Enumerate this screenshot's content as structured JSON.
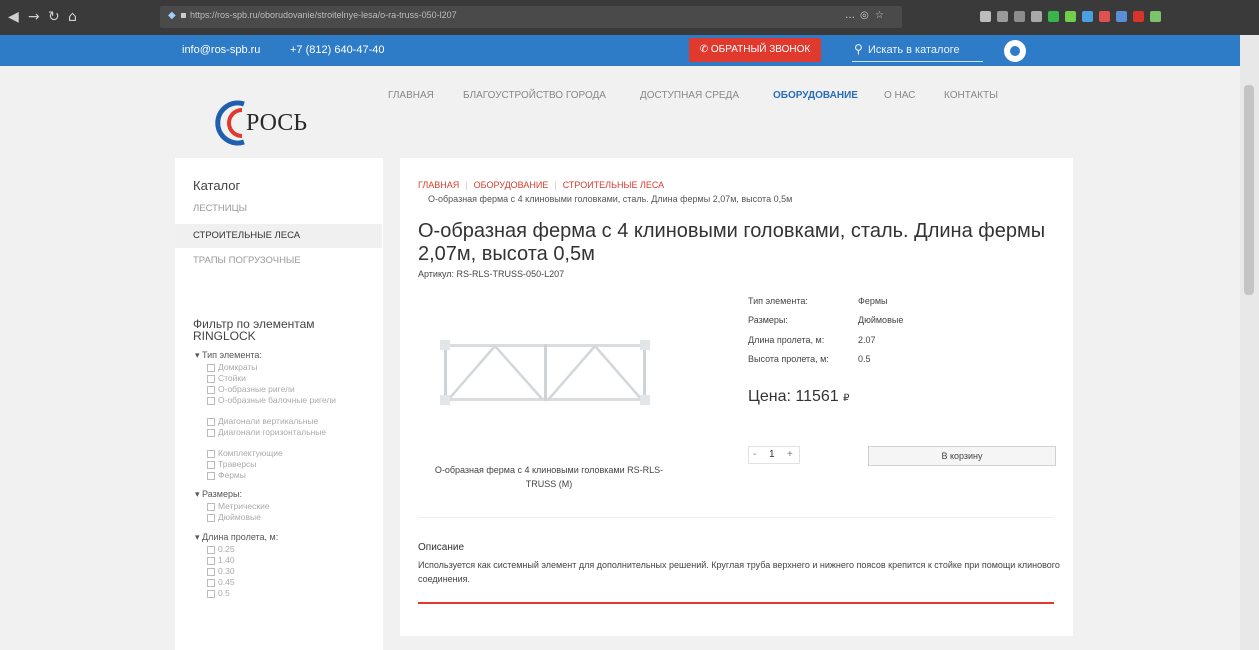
{
  "browser": {
    "url": "https://ros-spb.ru/oborudovanie/stroitelnye-lesa/o-ra-truss-050-l207",
    "url_domain": "ros-spb.ru"
  },
  "topbar": {
    "email": "info@ros-spb.ru",
    "phone": "+7 (812) 640-47-40",
    "callback": "ОБРАТНЫЙ ЗВОНОК",
    "search_placeholder": "Искать в каталоге"
  },
  "logo": {
    "text": "РОСЬ"
  },
  "nav": [
    "ГЛАВНАЯ",
    "БЛАГОУСТРОЙСТВО ГОРОДА",
    "ДОСТУПНАЯ СРЕДА",
    "ОБОРУДОВАНИЕ",
    "О НАС",
    "КОНТАКТЫ"
  ],
  "sidebar": {
    "title": "Каталог",
    "items": [
      "ЛЕСТНИЦЫ",
      "СТРОИТЕЛЬНЫЕ ЛЕСА",
      "ТРАПЫ ПОГРУЗОЧНЫЕ"
    ],
    "filter_title": "Фильтр по элементам RINGLOCK",
    "groups": [
      {
        "title": "Тип элемента",
        "options": [
          "Домкраты",
          "Стойки",
          "О-образные ригели",
          "О-образные балочные ригели",
          "Диагонали вертикальные",
          "Диагонали горизонтальные",
          "Комплектующие",
          "Траверсы",
          "Фермы"
        ]
      },
      {
        "title": "Размеры",
        "options": [
          "Метрические",
          "Дюймовые"
        ]
      },
      {
        "title": "Длина пролета, м",
        "options": [
          "0.25",
          "1.40",
          "0.30",
          "0.45",
          "0.5"
        ]
      }
    ]
  },
  "breadcrumb": {
    "items": [
      "ГЛАВНАЯ",
      "ОБОРУДОВАНИЕ",
      "СТРОИТЕЛЬНЫЕ ЛЕСА"
    ],
    "current": "О-образная ферма с 4 клиновыми головками, сталь. Длина фермы 2,07м, высота 0,5м"
  },
  "product": {
    "title": "О-образная ферма с 4 клиновыми головками, сталь. Длина фермы 2,07м, высота 0,5м",
    "sku": "Артикул: RS-RLS-TRUSS-050-L207",
    "attributes": [
      {
        "label": "Тип элемента:",
        "value": "Фермы"
      },
      {
        "label": "Размеры:",
        "value": "Дюймовые"
      },
      {
        "label": "Длина пролета, м:",
        "value": "2.07"
      },
      {
        "label": "Высота пролета, м:",
        "value": "0.5"
      }
    ],
    "price": "Цена: 11561",
    "currency": "₽",
    "qty": "1",
    "minus": "-",
    "plus": "+",
    "cart_button": "В корзину",
    "image_caption": "О-образная ферма с 4 клиновыми головками RS-RLS-TRUSS (M)",
    "description_title": "Описание",
    "description": "Используется как системный элемент для дополнительных решений. Круглая труба верхнего и нижнего поясов крепится к стойке при помощи клинового соединения."
  }
}
